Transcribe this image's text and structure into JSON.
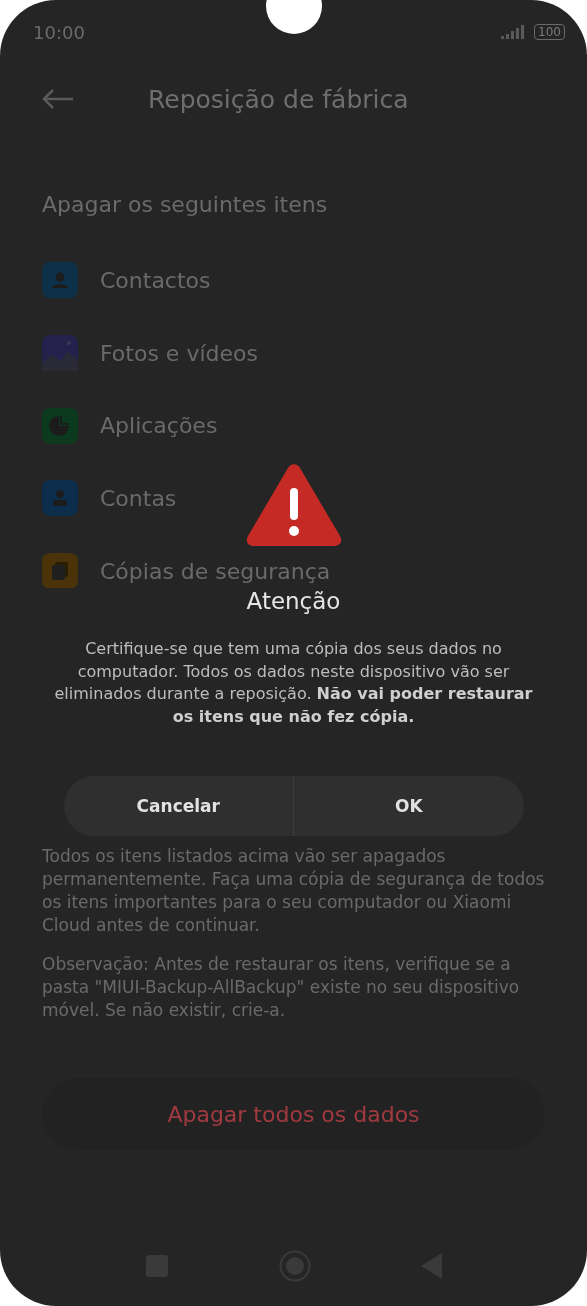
{
  "status_bar": {
    "time": "10:00",
    "battery": "100"
  },
  "header": {
    "title": "Reposição de fábrica"
  },
  "section_title": "Apagar os seguintes itens",
  "items": [
    {
      "label": "Contactos",
      "kind": "contact",
      "color": "#0d3148"
    },
    {
      "label": "Fotos e vídeos",
      "kind": "photo",
      "color": "#24224c"
    },
    {
      "label": "Aplicações",
      "kind": "apps",
      "color": "#0b3a1e"
    },
    {
      "label": "Contas",
      "kind": "account",
      "color": "#0c2e4c"
    },
    {
      "label": "Cópias de segurança",
      "kind": "backup",
      "color": "#4a3308"
    }
  ],
  "notes": [
    "Todos os itens listados acima vão ser apagados permanentemente. Faça uma cópia de segurança de todos os itens importantes para o seu computador ou Xiaomi Cloud antes de continuar.",
    "Observação: Antes de restaurar os itens, verifique se a pasta \"MIUI-Backup-AllBackup\" existe no seu dispositivo móvel. Se não existir, crie-a."
  ],
  "erase_button": "Apagar todos os dados",
  "dialog": {
    "title": "Atenção",
    "message": "Certifique-se que tem uma cópia dos seus dados no computador. Todos os dados neste dispositivo vão ser eliminados durante a reposição. **Não vai poder restaurar os itens que não fez cópia.**",
    "buttons": [
      "Cancelar",
      "OK"
    ]
  }
}
